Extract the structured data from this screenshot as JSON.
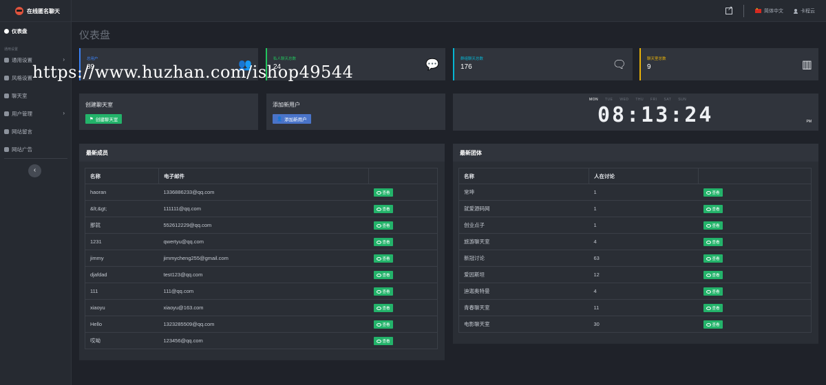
{
  "app": {
    "title": "在线匿名聊天"
  },
  "header": {
    "language": "简体中文",
    "username": "卡程云"
  },
  "sidebar": {
    "section_label": "通用设置",
    "items": [
      {
        "label": "仪表盘",
        "icon": "dashboard-icon",
        "active": true
      },
      {
        "label": "通用设置",
        "icon": "gear-icon",
        "chevron": true
      },
      {
        "label": "风格设置",
        "icon": "paint-icon"
      },
      {
        "label": "聊天室",
        "icon": "chat-icon"
      },
      {
        "label": "用户管理",
        "icon": "users-icon",
        "chevron": true
      },
      {
        "label": "网站留言",
        "icon": "message-icon"
      },
      {
        "label": "网站广告",
        "icon": "ad-icon"
      }
    ]
  },
  "page": {
    "title": "仪表盘"
  },
  "stats": [
    {
      "label": "总用户",
      "value": "89",
      "color": "#3b82f6",
      "icon": "users-icon"
    },
    {
      "label": "私人聊天总数",
      "value": "24",
      "color": "#22c55e",
      "icon": "comment-icon"
    },
    {
      "label": "群组聊天总数",
      "value": "176",
      "color": "#06b6d4",
      "icon": "comments-icon"
    },
    {
      "label": "聊天室总数",
      "value": "9",
      "color": "#eab308",
      "icon": "building-icon"
    }
  ],
  "actions": {
    "create_room": {
      "title": "创建聊天室",
      "button": "创建聊天室"
    },
    "add_user": {
      "title": "添加新用户",
      "button": "添加新用户"
    }
  },
  "clock": {
    "days": [
      "MON",
      "TUE",
      "WED",
      "THU",
      "FRI",
      "SAT",
      "SUN"
    ],
    "active_day": "MON",
    "time": "08:13:24",
    "ampm": "PM"
  },
  "members": {
    "title": "最新成员",
    "columns": [
      "名称",
      "电子邮件",
      ""
    ],
    "view_label": "查看",
    "rows": [
      {
        "name": "haoran",
        "email": "1336886233@qq.com"
      },
      {
        "name": "&lt;&gt;",
        "email": "111111@qq.com"
      },
      {
        "name": "那就",
        "email": "552612229@qq.com"
      },
      {
        "name": "1231",
        "email": "qwertyu@qq.com"
      },
      {
        "name": "jimmy",
        "email": "jimmycheng255@gmail.com"
      },
      {
        "name": "djafdad",
        "email": "test123@qq.com"
      },
      {
        "name": "111",
        "email": "111@qq.com"
      },
      {
        "name": "xiaoyu",
        "email": "xiaoyu@163.com"
      },
      {
        "name": "Hello",
        "email": "1323285509@qq.com"
      },
      {
        "name": "哎呦",
        "email": "123456@qq.com"
      }
    ]
  },
  "groups": {
    "title": "最新团体",
    "columns": [
      "名称",
      "人在讨论",
      ""
    ],
    "view_label": "查看",
    "rows": [
      {
        "name": "常坤",
        "count": "1"
      },
      {
        "name": "就爱源码网",
        "count": "1"
      },
      {
        "name": "创业点子",
        "count": "1"
      },
      {
        "name": "旅游聊天室",
        "count": "4"
      },
      {
        "name": "新冠讨论",
        "count": "63"
      },
      {
        "name": "爱因斯坦",
        "count": "12"
      },
      {
        "name": "迪迦奥特曼",
        "count": "4"
      },
      {
        "name": "青春聊天室",
        "count": "11"
      },
      {
        "name": "电影聊天室",
        "count": "30"
      }
    ]
  },
  "watermark": "https://www.huzhan.com/ishop49544"
}
